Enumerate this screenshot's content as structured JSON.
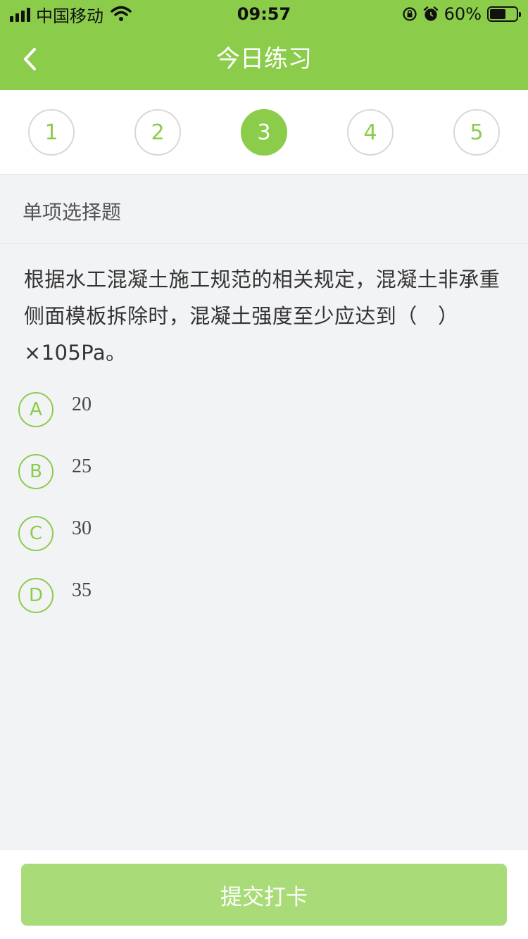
{
  "status_bar": {
    "carrier": "中国移动",
    "time": "09:57",
    "battery_percent": "60%",
    "battery_level": 0.6,
    "icons": [
      "signal-icon",
      "wifi-icon",
      "orientation-lock-icon",
      "alarm-icon",
      "battery-icon"
    ]
  },
  "nav": {
    "title": "今日练习",
    "back_icon": "chevron-left-icon"
  },
  "steps": {
    "items": [
      "1",
      "2",
      "3",
      "4",
      "5"
    ],
    "active_index": 2
  },
  "section": {
    "title": "单项选择题"
  },
  "question": {
    "text": "根据水工混凝土施工规范的相关规定，混凝土非承重侧面模板拆除时，混凝土强度至少应达到（　）×105Pa。"
  },
  "options": [
    {
      "letter": "A",
      "text": "20"
    },
    {
      "letter": "B",
      "text": "25"
    },
    {
      "letter": "C",
      "text": "30"
    },
    {
      "letter": "D",
      "text": "35"
    }
  ],
  "footer": {
    "submit_label": "提交打卡"
  },
  "colors": {
    "primary": "#8bcc4b",
    "primary_light": "#a9dc78",
    "background": "#f2f3f5"
  }
}
